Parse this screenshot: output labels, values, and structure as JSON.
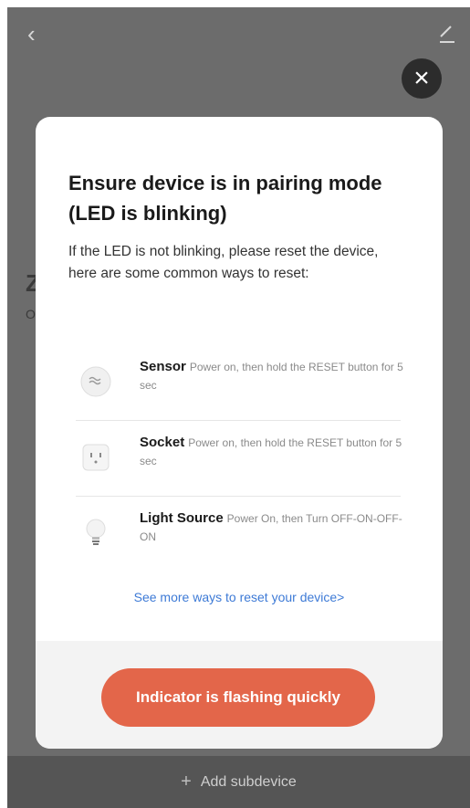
{
  "header": {
    "back_icon": "chevron-left-icon",
    "edit_icon": "pencil-icon"
  },
  "background": {
    "title_fragment": "Z",
    "subtitle_fragment": "O"
  },
  "modal": {
    "close_icon": "close-icon",
    "title": "Ensure device is in pairing mode (LED is blinking)",
    "description": "If the LED is not blinking, please reset the device, here are some common ways to reset:",
    "methods": [
      {
        "icon": "sensor-icon",
        "name": "Sensor",
        "instruction": "Power on, then hold the RESET button for 5 sec"
      },
      {
        "icon": "socket-icon",
        "name": "Socket",
        "instruction": "Power on, then hold the RESET button for 5 sec"
      },
      {
        "icon": "light-bulb-icon",
        "name": "Light Source",
        "instruction": "Power On, then Turn OFF-ON-OFF-ON"
      }
    ],
    "more_link": "See more ways to reset your device>",
    "primary_button": "Indicator is flashing quickly"
  },
  "bottom_bar": {
    "icon": "plus-icon",
    "label": "Add subdevice"
  },
  "colors": {
    "accent": "#e3664a",
    "link": "#3d7ad6",
    "overlay": "#6c6c6c"
  }
}
